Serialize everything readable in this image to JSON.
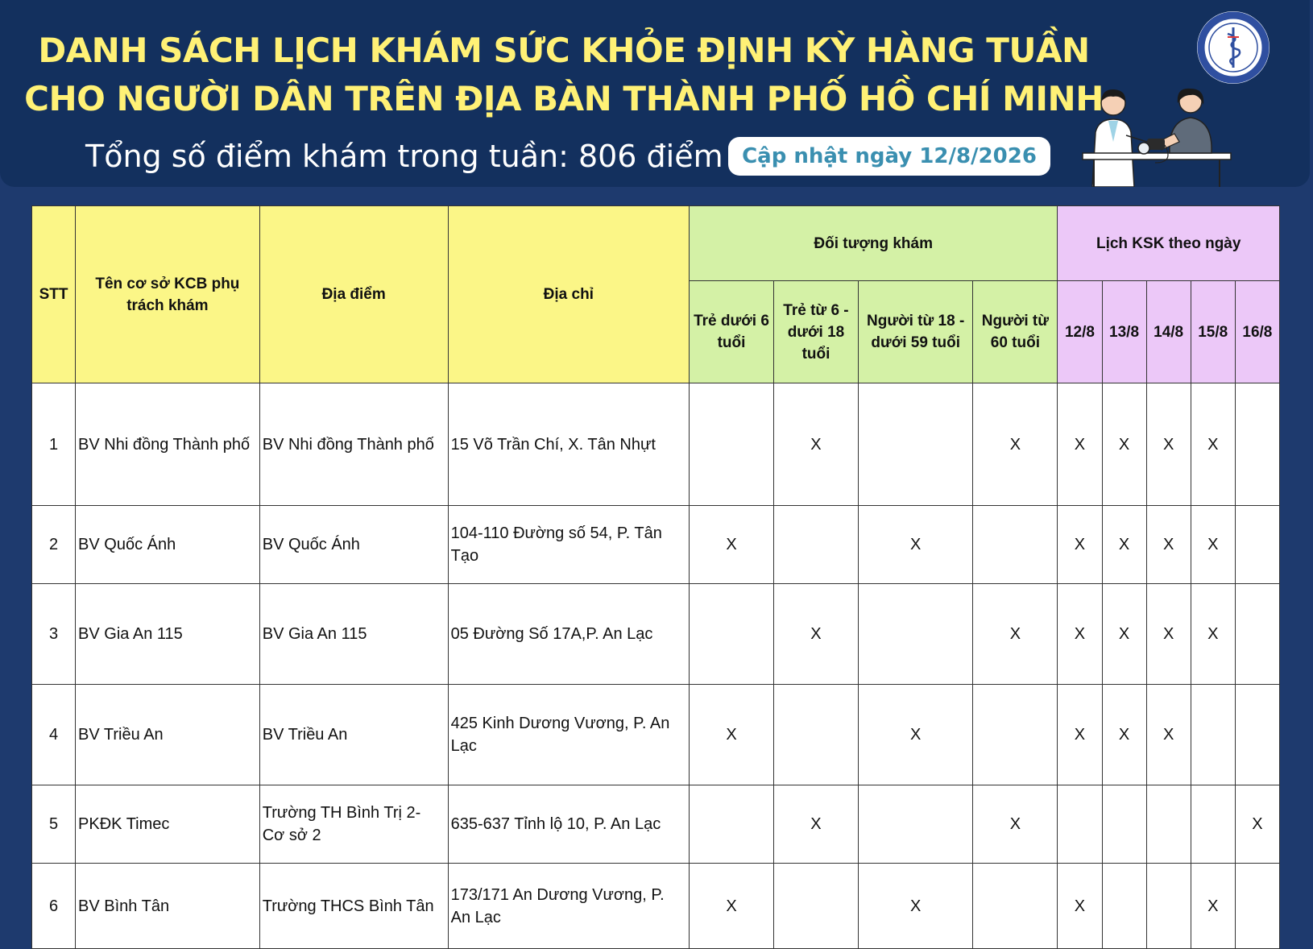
{
  "header": {
    "title_line1": "DANH SÁCH LỊCH KHÁM SỨC KHỎE ĐỊNH KỲ HÀNG TUẦN",
    "title_line2": "CHO NGƯỜI DÂN TRÊN ĐỊA BÀN THÀNH PHỐ HỒ CHÍ MINH",
    "total_points": "Tổng số điểm khám trong tuần: 806 điểm",
    "updated": "Cập nhật ngày 12/8/2026",
    "logo_icon": "health-department-seal-icon",
    "illustration": "doctor-measuring-blood-pressure-illustration"
  },
  "colors": {
    "background": "#1e3a6e",
    "header_bg": "#13305e",
    "title": "#fff176",
    "yellow_header": "#fbf687",
    "green_header": "#d4f1a6",
    "purple_header": "#ecc8f8",
    "updated_text": "#3a8fb0"
  },
  "table": {
    "headers": {
      "stt": "STT",
      "facility": "Tên cơ sở KCB phụ trách khám",
      "location": "Địa điểm",
      "address": "Địa chỉ",
      "subjects_group": "Đối tượng khám",
      "schedule_group": "Lịch KSK theo ngày"
    },
    "subject_columns": [
      "Trẻ dưới 6 tuổi",
      "Trẻ từ 6 - dưới 18 tuổi",
      "Người từ 18 - dưới 59 tuổi",
      "Người từ 60 tuổi"
    ],
    "date_columns": [
      "12/8",
      "13/8",
      "14/8",
      "15/8",
      "16/8"
    ],
    "rows": [
      {
        "stt": "1",
        "facility": "BV Nhi đồng Thành phố",
        "location": "BV Nhi đồng Thành phố",
        "address": "15 Võ Trần Chí, X. Tân Nhựt",
        "subjects": [
          "",
          "X",
          "",
          "X"
        ],
        "dates": [
          "X",
          "X",
          "X",
          "X",
          ""
        ]
      },
      {
        "stt": "2",
        "facility": "BV Quốc Ánh",
        "location": "BV Quốc Ánh",
        "address": "104-110 Đường số 54, P. Tân Tạo",
        "subjects": [
          "X",
          "",
          "X",
          ""
        ],
        "dates": [
          "X",
          "X",
          "X",
          "X",
          ""
        ]
      },
      {
        "stt": "3",
        "facility": "BV Gia An 115",
        "location": "BV Gia An 115",
        "address": "05 Đường Số 17A,P. An Lạc",
        "subjects": [
          "",
          "X",
          "",
          "X"
        ],
        "dates": [
          "X",
          "X",
          "X",
          "X",
          ""
        ]
      },
      {
        "stt": "4",
        "facility": "BV Triều An",
        "location": "BV Triều An",
        "address": "425 Kinh Dương Vương, P. An Lạc",
        "subjects": [
          "X",
          "",
          "X",
          ""
        ],
        "dates": [
          "X",
          "X",
          "X",
          "",
          ""
        ]
      },
      {
        "stt": "5",
        "facility": "PKĐK Timec",
        "location": "Trường TH Bình Trị 2- Cơ sở 2",
        "address": "635-637 Tỉnh lộ 10, P. An Lạc",
        "subjects": [
          "",
          "X",
          "",
          "X"
        ],
        "dates": [
          "",
          "",
          "",
          "",
          "X"
        ]
      },
      {
        "stt": "6",
        "facility": "BV Bình Tân",
        "location": "Trường THCS Bình Tân",
        "address": "173/171 An Dương Vương, P. An Lạc",
        "subjects": [
          "X",
          "",
          "X",
          ""
        ],
        "dates": [
          "X",
          "",
          "",
          "X",
          ""
        ]
      }
    ]
  }
}
